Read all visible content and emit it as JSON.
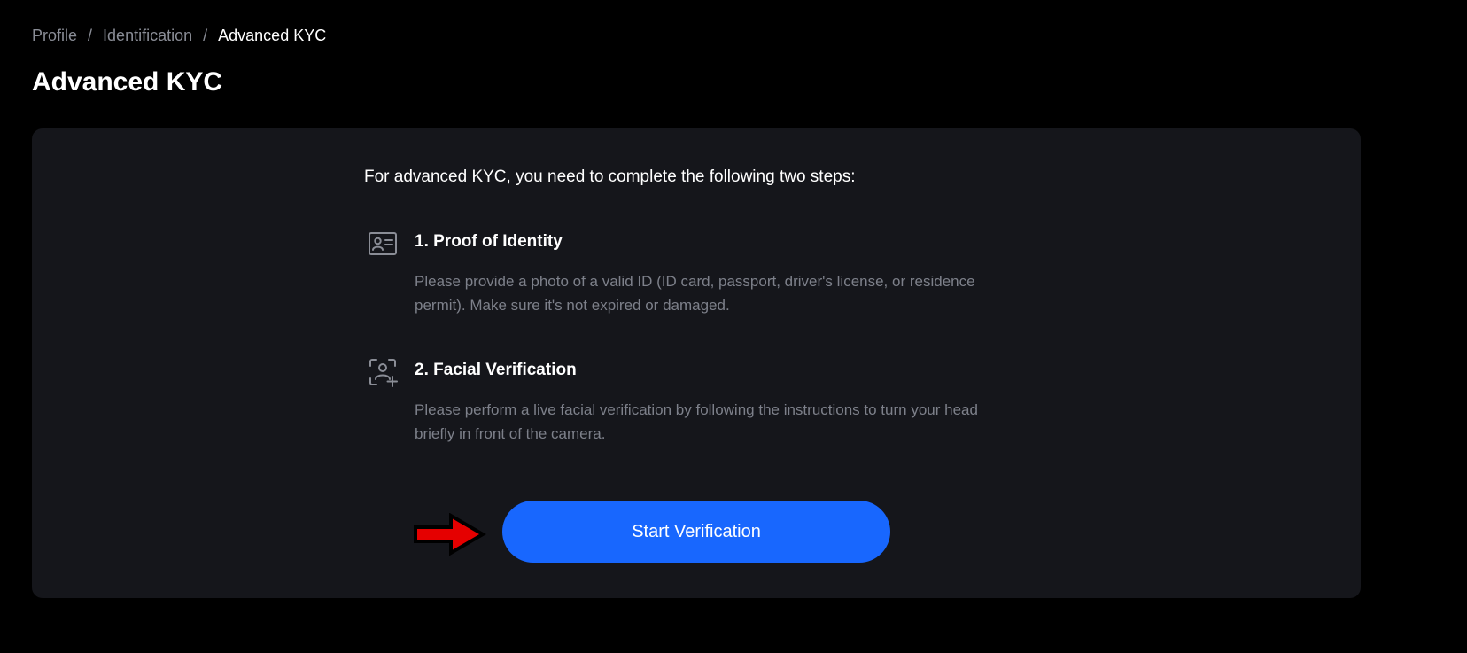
{
  "breadcrumb": {
    "items": [
      "Profile",
      "Identification"
    ],
    "separator": "/",
    "current": "Advanced KYC"
  },
  "page": {
    "title": "Advanced KYC"
  },
  "card": {
    "intro": "For advanced KYC, you need to complete the following two steps:",
    "steps": [
      {
        "icon": "id-card-icon",
        "title": "1. Proof of Identity",
        "description": "Please provide a photo of a valid ID (ID card, passport, driver's license, or residence permit). Make sure it's not expired or damaged."
      },
      {
        "icon": "face-scan-icon",
        "title": "2. Facial Verification",
        "description": "Please perform a live facial verification by following the instructions to turn your head briefly in front of the camera."
      }
    ],
    "button_label": "Start Verification",
    "annotation_icon": "red-arrow-icon"
  },
  "colors": {
    "background": "#000000",
    "card": "#15161b",
    "accent": "#1867fe",
    "muted_text": "#7d808a",
    "annotation": "#e50000"
  }
}
